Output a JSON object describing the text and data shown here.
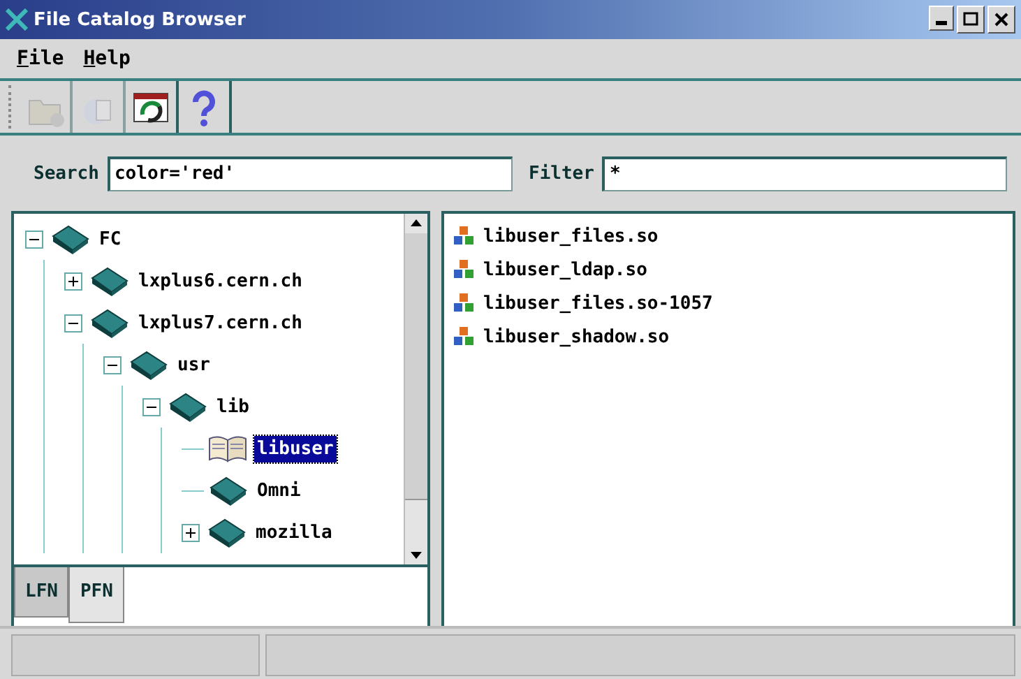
{
  "window": {
    "title": "File Catalog Browser"
  },
  "menu": [
    "File",
    "Help"
  ],
  "toolbar": [
    {
      "kind": "open",
      "disabled": true
    },
    {
      "kind": "doc",
      "disabled": true
    },
    {
      "kind": "refresh",
      "disabled": false
    },
    {
      "kind": "help",
      "disabled": false
    }
  ],
  "search": {
    "label": "Search",
    "value": "color='red'"
  },
  "filter": {
    "label": "Filter",
    "value": "*"
  },
  "tree": [
    {
      "label": "FC",
      "expanded": true,
      "selected": false,
      "children": [
        {
          "label": "lxplus6.cern.ch",
          "expanded": false,
          "selected": false
        },
        {
          "label": "lxplus7.cern.ch",
          "expanded": true,
          "selected": false,
          "children": [
            {
              "label": "usr",
              "expanded": true,
              "selected": false,
              "children": [
                {
                  "label": "lib",
                  "expanded": true,
                  "selected": false,
                  "children": [
                    {
                      "label": "libuser",
                      "selected": true
                    },
                    {
                      "label": "Omni",
                      "selected": false
                    },
                    {
                      "label": "mozilla",
                      "expanded": false,
                      "selected": false
                    }
                  ]
                }
              ]
            }
          ]
        }
      ]
    }
  ],
  "tabs": [
    {
      "label": "LFN",
      "selected": false
    },
    {
      "label": "PFN",
      "selected": true
    }
  ],
  "files": [
    "libuser_files.so",
    "libuser_ldap.so",
    "libuser_files.so-1057",
    "libuser_shadow.so"
  ]
}
